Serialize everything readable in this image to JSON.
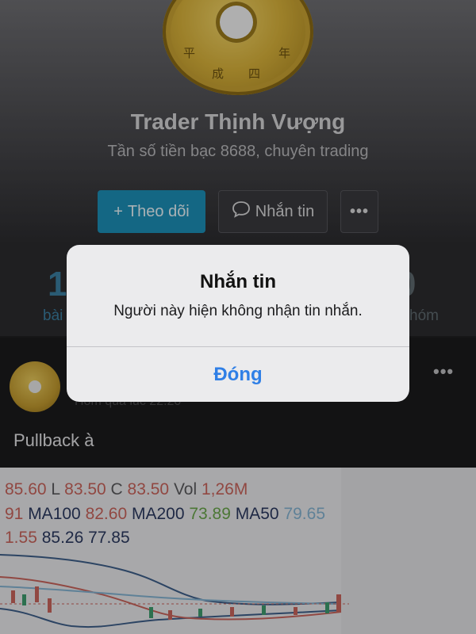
{
  "profile": {
    "name": "Trader Thịnh Vượng",
    "bio": "Tần số tiền bạc 8688, chuyên trading",
    "avatar_glyphs": [
      "平",
      "成",
      "四",
      "年"
    ]
  },
  "actions": {
    "follow_icon": "+",
    "follow_label": "Theo dõi",
    "message_icon": "chat-bubble-icon",
    "message_label": "Nhắn tin",
    "more_label": "•••"
  },
  "stats": {
    "posts_count_partial": "1",
    "posts_label_partial": "bài",
    "groups_count_partial": "0",
    "groups_label_partial": "hóm"
  },
  "post": {
    "time_partial": "Hôm qua lúc 22:20",
    "more_label": "•••",
    "text": "Pullback à"
  },
  "chart_image": {
    "line1": [
      {
        "text": "85.60",
        "color": "red"
      },
      {
        "text": " L ",
        "color": "gray"
      },
      {
        "text": "83.50",
        "color": "red"
      },
      {
        "text": " C ",
        "color": "gray"
      },
      {
        "text": "83.50",
        "color": "red"
      },
      {
        "text": " Vol ",
        "color": "gray"
      },
      {
        "text": "1,26M",
        "color": "red"
      }
    ],
    "line2": [
      {
        "text": "91",
        "color": "red"
      },
      {
        "text": " MA100 ",
        "color": "navy"
      },
      {
        "text": "82.60",
        "color": "red"
      },
      {
        "text": " MA200 ",
        "color": "navy"
      },
      {
        "text": "73.89",
        "color": "green"
      },
      {
        "text": " MA50 ",
        "color": "navy"
      },
      {
        "text": "79.65",
        "color": "blue"
      }
    ],
    "line3": [
      {
        "text": "1.55",
        "color": "red"
      },
      {
        "text": " 85.26 77.85",
        "color": "navy"
      }
    ]
  },
  "alert": {
    "title": "Nhắn tin",
    "message": "Người này hiện không nhận tin nhắn.",
    "button": "Đóng"
  },
  "colors": {
    "accent": "#1d8fb8",
    "alert_button": "#2f7fe6"
  }
}
